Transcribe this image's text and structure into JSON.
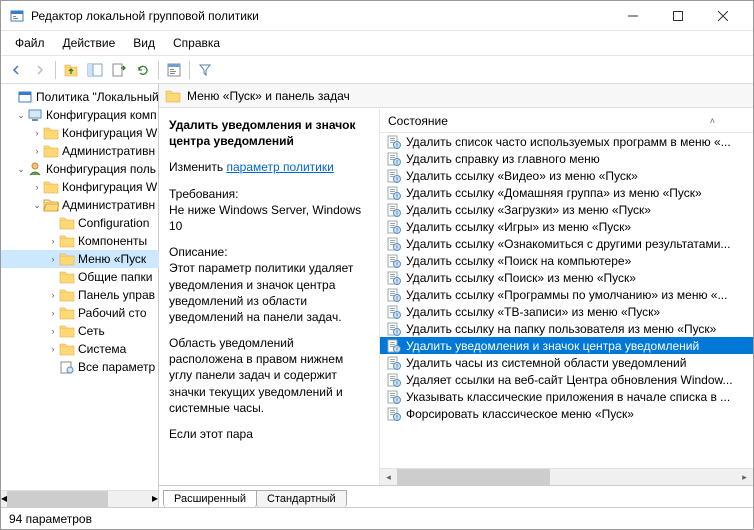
{
  "window": {
    "title": "Редактор локальной групповой политики"
  },
  "menu": {
    "file": "Файл",
    "action": "Действие",
    "view": "Вид",
    "help": "Справка"
  },
  "tree": {
    "root": "Политика \"Локальный",
    "cc": "Конфигурация комп",
    "cc_sw": "Конфигурация W",
    "cc_adm": "Административн",
    "uc": "Конфигурация поль",
    "uc_sw": "Конфигурация W",
    "uc_adm": "Административн",
    "configuration": "Configuration",
    "components": "Компоненты",
    "startmenu": "Меню «Пуск",
    "shared": "Общие папки",
    "panel": "Панель управ",
    "desktop": "Рабочий сто",
    "network": "Сеть",
    "system": "Система",
    "allparams": "Все параметр"
  },
  "header": {
    "title": "Меню «Пуск» и панель задач"
  },
  "desc": {
    "title": "Удалить уведомления и значок центра уведомлений",
    "change": "Изменить",
    "link": "параметр политики",
    "req_label": "Требования:",
    "req_text": "Не ниже Windows Server, Windows 10",
    "d_label": "Описание:",
    "d_text": "Этот параметр политики удаляет уведомления и значок центра уведомлений из области уведомлений на панели задач.",
    "d_text2": "Область уведомлений расположена в правом нижнем углу панели задач и содержит значки текущих уведомлений и системные часы.",
    "d_text3": "Если этот пара"
  },
  "colhead": "Состояние",
  "items": [
    "Удалить список часто используемых программ в меню «...",
    "Удалить справку из главного меню",
    "Удалить ссылку «Видео» из меню «Пуск»",
    "Удалить ссылку «Домашняя группа» из меню «Пуск»",
    "Удалить ссылку «Загрузки» из меню «Пуск»",
    "Удалить ссылку «Игры» из меню «Пуск»",
    "Удалить ссылку «Ознакомиться с другими результатами...",
    "Удалить ссылку «Поиск на компьютере»",
    "Удалить ссылку «Поиск» из меню «Пуск»",
    "Удалить ссылку «Программы по умолчанию» из меню «...",
    "Удалить ссылку «ТВ-записи» из меню «Пуск»",
    "Удалить ссылку на папку пользователя из меню «Пуск»",
    "Удалить уведомления и значок центра уведомлений",
    "Удалить часы из системной области уведомлений",
    "Удаляет ссылки на веб-сайт Центра обновления Window...",
    "Указывать классические приложения в начале списка в ...",
    "Форсировать классическое меню «Пуск»"
  ],
  "selected_index": 12,
  "tabs": {
    "extended": "Расширенный",
    "standard": "Стандартный"
  },
  "status": "94 параметров"
}
